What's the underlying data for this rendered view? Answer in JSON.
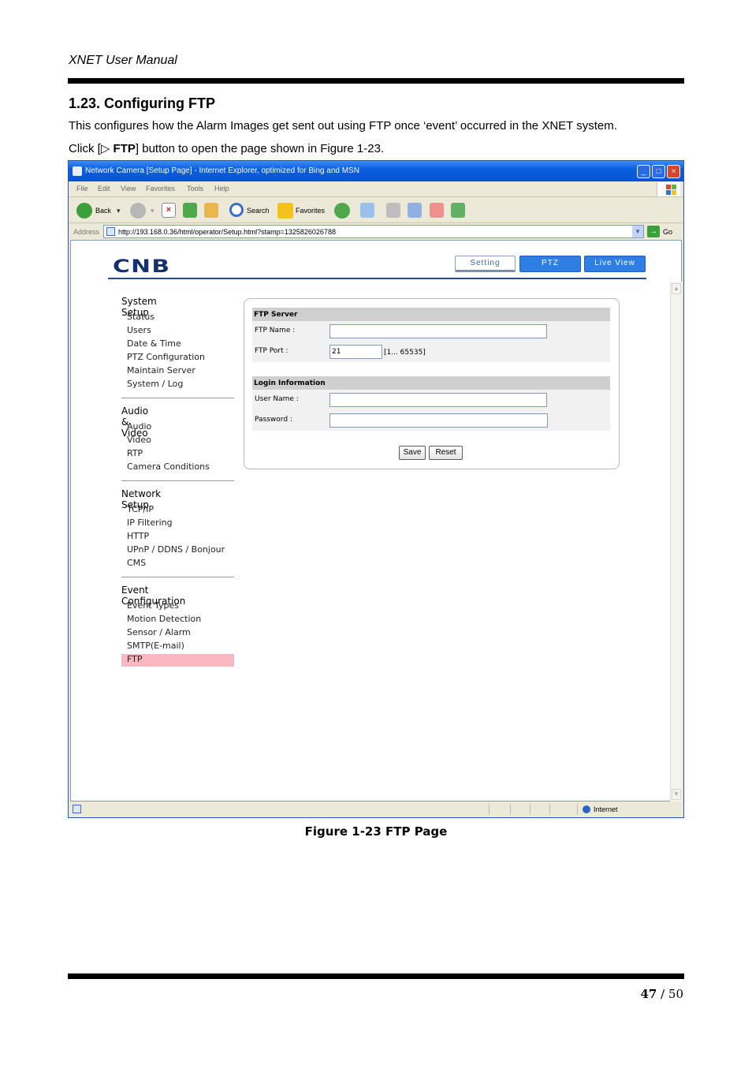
{
  "doc": {
    "header": "XNET User Manual",
    "section_title": "1.23. Configuring FTP",
    "para1": "This configures how the Alarm Images get sent out using FTP once ‘event’ occurred in the XNET system.",
    "para2_pre": "Click [▷ ",
    "para2_bold": "FTP",
    "para2_post": "] button to open the page shown in Figure 1-23.",
    "caption": "Figure 1-23 FTP Page",
    "page_current": "47",
    "page_sep": " / ",
    "page_total": "50"
  },
  "browser": {
    "title": "Network Camera [Setup Page] - Internet Explorer, optimized for Bing and MSN",
    "menu": [
      "File",
      "Edit",
      "View",
      "Favorites",
      "Tools",
      "Help"
    ],
    "toolbar": {
      "back": "Back",
      "search": "Search",
      "favorites": "Favorites"
    },
    "address_label": "Address",
    "url": "http://193.168.0.36/html/operator/Setup.html?stamp=1325826026788",
    "go": "Go",
    "status_zone": "Internet"
  },
  "app": {
    "logo": "CNB",
    "nav": {
      "setting": "Setting",
      "ptz": "PTZ",
      "live": "Live View"
    },
    "sidebar": [
      {
        "title": "System Setup",
        "items": [
          "Status",
          "Users",
          "Date & Time",
          "PTZ Configuration",
          "Maintain Server",
          "System / Log"
        ]
      },
      {
        "title": "Audio & Video",
        "items": [
          "Audio",
          "Video",
          "RTP",
          "Camera Conditions"
        ]
      },
      {
        "title": "Network Setup",
        "items": [
          "TCP/IP",
          "IP Filtering",
          "HTTP",
          "UPnP / DDNS / Bonjour",
          "CMS"
        ]
      },
      {
        "title": "Event Configuration",
        "items": [
          "Event Types",
          "Motion Detection",
          "Sensor / Alarm",
          "SMTP(E-mail)",
          "FTP"
        ]
      }
    ],
    "form": {
      "ftp_server_heading": "FTP Server",
      "ftp_name_label": "FTP Name :",
      "ftp_name_value": "",
      "ftp_port_label": "FTP Port :",
      "ftp_port_value": "21",
      "ftp_port_hint": "[1... 65535]",
      "login_heading": "Login Information",
      "user_label": "User Name :",
      "user_value": "",
      "password_label": "Password :",
      "password_value": "",
      "save": "Save",
      "reset": "Reset"
    }
  },
  "colors": {
    "active_item": "#f7b9bf",
    "nav_blue": "#2e7fe4",
    "titlebar": "#0a5ee0"
  }
}
